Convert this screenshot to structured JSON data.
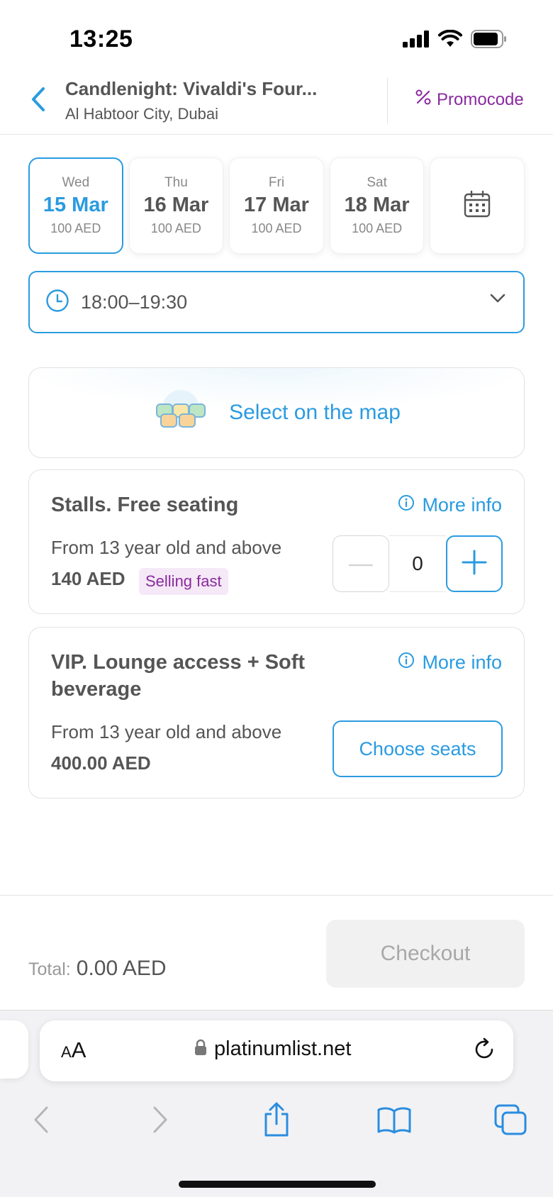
{
  "status_bar": {
    "time": "13:25",
    "icons": [
      "signal-icon",
      "wifi-icon",
      "battery-icon"
    ]
  },
  "header": {
    "back_icon": "chevron-left-icon",
    "title": "Candlenight: Vivaldi's Four...",
    "subtitle": "Al Habtoor City, Dubai",
    "promo_icon": "percent-icon",
    "promo_label": "Promocode"
  },
  "dates": [
    {
      "dow": "Wed",
      "day": "15 Mar",
      "price": "100 AED",
      "selected": true
    },
    {
      "dow": "Thu",
      "day": "16 Mar",
      "price": "100 AED",
      "selected": false
    },
    {
      "dow": "Fri",
      "day": "17 Mar",
      "price": "100 AED",
      "selected": false
    },
    {
      "dow": "Sat",
      "day": "18 Mar",
      "price": "100 AED",
      "selected": false
    }
  ],
  "calendar_icon": "calendar-icon",
  "time_select": {
    "value": "18:00–19:30",
    "icon": "clock-icon"
  },
  "map_select": {
    "label": "Select on the map",
    "icon": "seats-icon"
  },
  "tickets": [
    {
      "title": "Stalls. Free seating",
      "more_info": "More info",
      "age": "From 13 year old and above",
      "price": "140 AED",
      "badge": "Selling fast",
      "quantity": "0"
    },
    {
      "title_line1": "VIP. Lounge access + Soft",
      "title_line2": "beverage",
      "more_info": "More info",
      "age": "From 13 year old and above",
      "price": "400.00 AED",
      "action": "Choose seats"
    }
  ],
  "footer": {
    "total_label": "Total:",
    "total_value": "0.00 AED",
    "checkout": "Checkout"
  },
  "browser": {
    "text_size_small": "A",
    "text_size_large": "A",
    "url": "platinumlist.net",
    "toolbar": [
      "back-icon",
      "forward-icon",
      "share-icon",
      "bookmarks-icon",
      "tabs-icon"
    ]
  },
  "colors": {
    "accent": "#2a9be0",
    "promo": "#8a2a9e",
    "text": "#555555",
    "badge_bg": "#f5e9f7",
    "disabled": "#a8a8a8"
  }
}
